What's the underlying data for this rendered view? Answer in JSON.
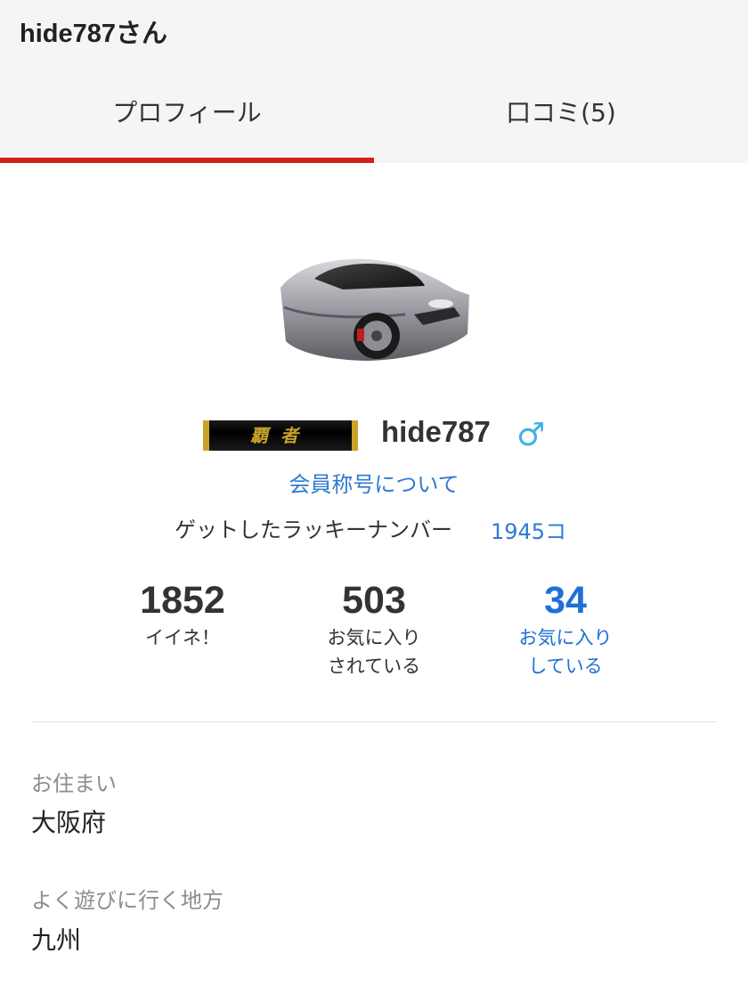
{
  "header": {
    "title": "hide787さん"
  },
  "tabs": [
    {
      "label": "プロフィール",
      "active": true
    },
    {
      "label": "口コミ(5)",
      "active": false
    }
  ],
  "colors": {
    "accent": "#d4201b",
    "link": "#2f7ad1",
    "gender": "#42b2e6",
    "header_bg": "#f5f5f5"
  },
  "profile": {
    "avatar": "car-photo",
    "rank_badge": "覇者",
    "username": "hide787",
    "gender_icon": "♂",
    "rank_link": "会員称号について",
    "lucky_label": "ゲットしたラッキーナンバー",
    "lucky_value": "1945コ"
  },
  "stats": [
    {
      "value": "1852",
      "label_line1": "イイネ！",
      "label_line2": ""
    },
    {
      "value": "503",
      "label_line1": "お気に入り",
      "label_line2": "されている"
    },
    {
      "value": "34",
      "label_line1": "お気に入り",
      "label_line2": "している"
    }
  ],
  "details": [
    {
      "label": "お住まい",
      "value": "大阪府"
    },
    {
      "label": "よく遊びに行く地方",
      "value": "九州"
    }
  ]
}
